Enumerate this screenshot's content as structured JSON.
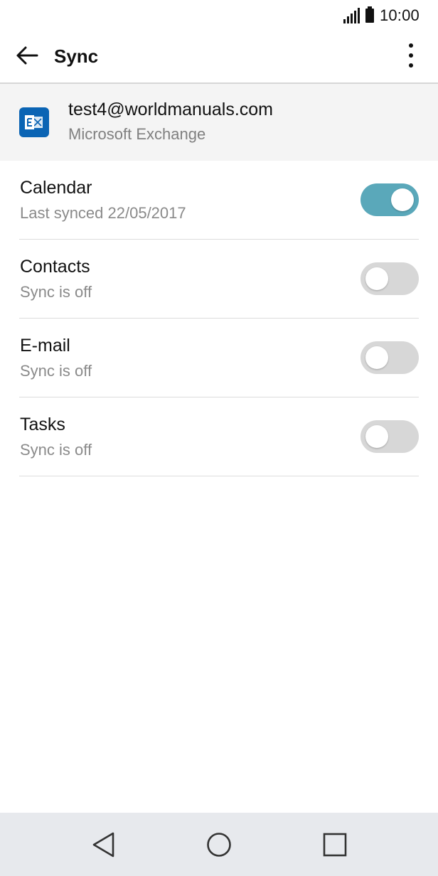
{
  "status_bar": {
    "time": "10:00",
    "icons": [
      "signal-icon",
      "battery-icon"
    ]
  },
  "app_bar": {
    "title": "Sync",
    "back_icon": "arrow-left-icon",
    "menu_icon": "more-vert-icon"
  },
  "account": {
    "email": "test4@worldmanuals.com",
    "type": "Microsoft Exchange",
    "icon": "exchange-icon",
    "brand_color": "#0a64b4"
  },
  "sync_items": [
    {
      "title": "Calendar",
      "subtitle": "Last synced 22/05/2017",
      "enabled": true
    },
    {
      "title": "Contacts",
      "subtitle": "Sync is off",
      "enabled": false
    },
    {
      "title": "E-mail",
      "subtitle": "Sync is off",
      "enabled": false
    },
    {
      "title": "Tasks",
      "subtitle": "Sync is off",
      "enabled": false
    }
  ],
  "colors": {
    "toggle_on": "#5aa8ba",
    "toggle_off": "#d7d7d7",
    "nav_bar": "#e7e9ed",
    "header_bg": "#f4f4f4"
  },
  "nav_bar": {
    "buttons": [
      "back-triangle-icon",
      "home-circle-icon",
      "recents-square-icon"
    ]
  }
}
